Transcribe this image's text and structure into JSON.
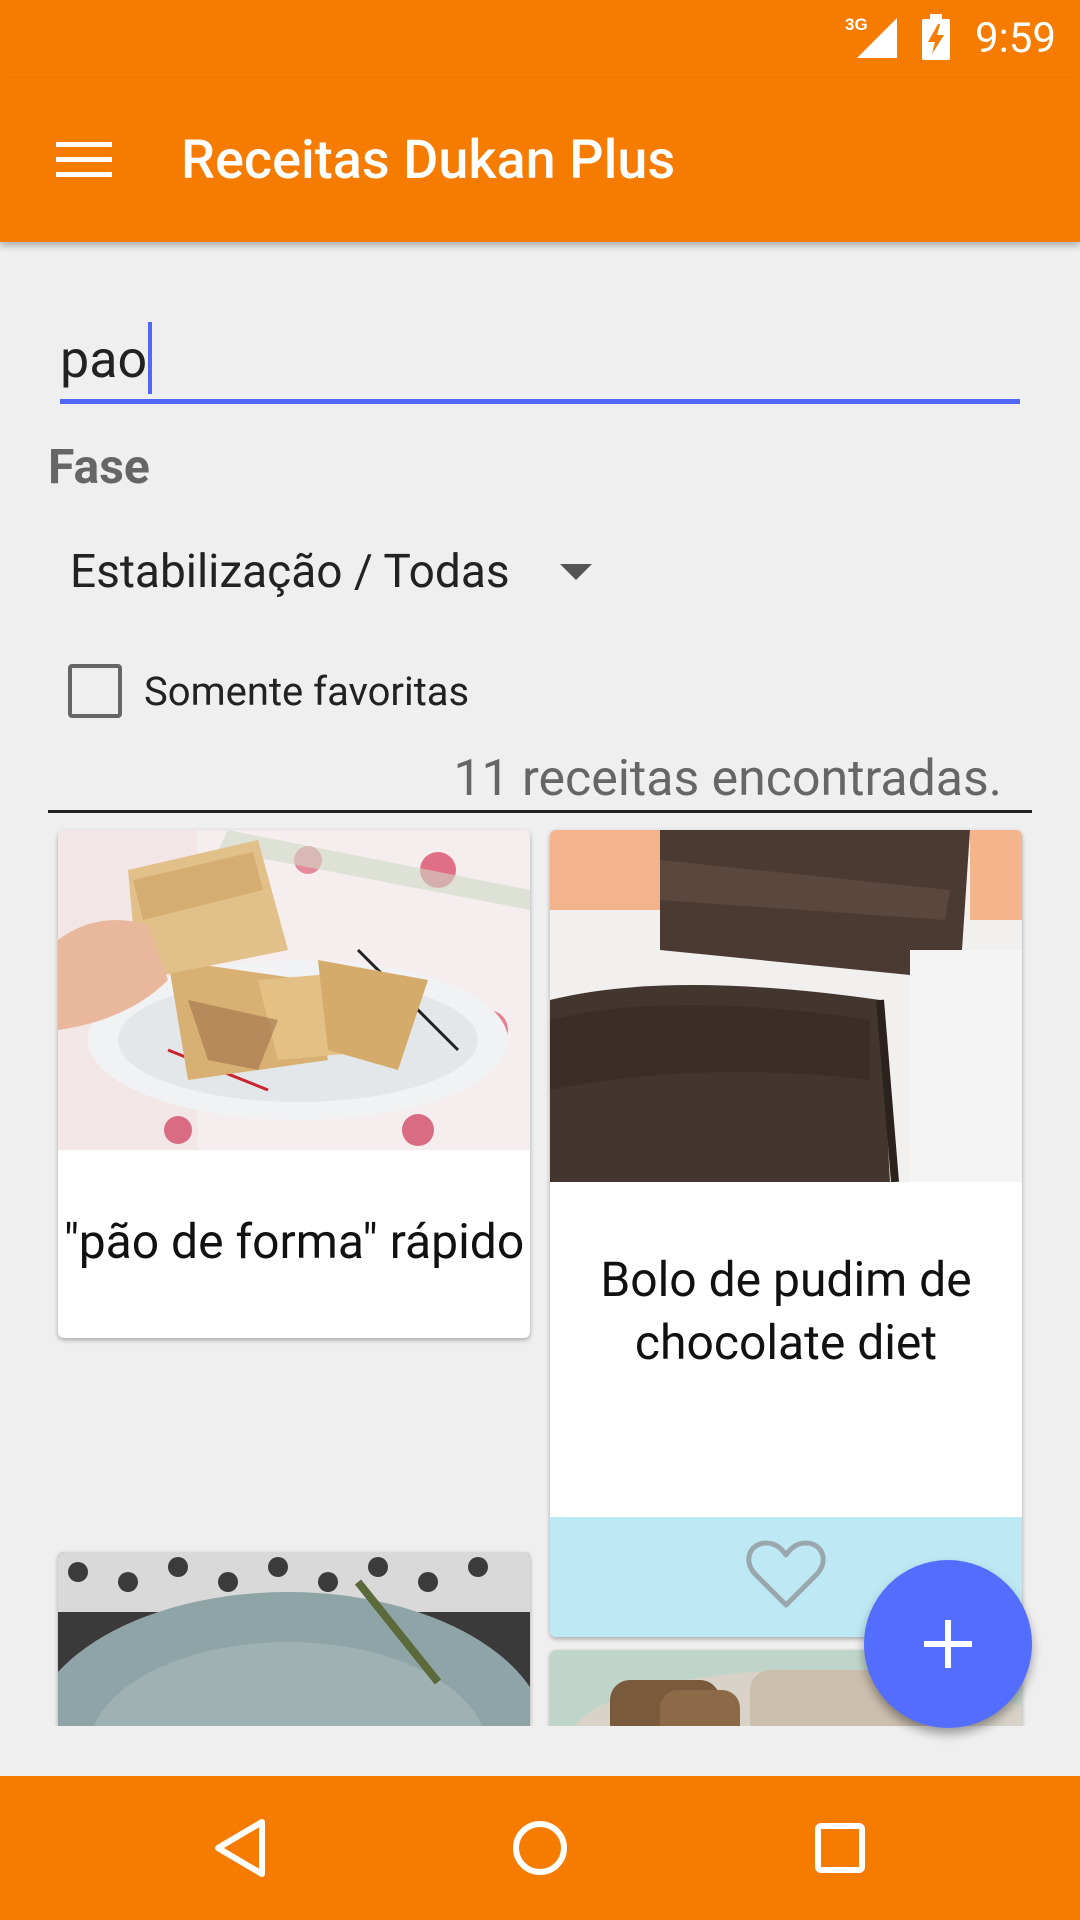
{
  "status_bar": {
    "time": "9:59",
    "network": "3G",
    "network_icon": "signal-3g-icon",
    "battery_icon": "battery-charging-icon"
  },
  "app_bar": {
    "title": "Receitas Dukan Plus",
    "menu_icon": "hamburger-menu-icon",
    "color": "#f57c00"
  },
  "search": {
    "value": "pao"
  },
  "filter": {
    "phase_label": "Fase",
    "phase_selected": "Estabilização / Todas",
    "favorites_only_label": "Somente favoritas",
    "favorites_only_checked": false
  },
  "results": {
    "count_text": "11 receitas encontradas."
  },
  "recipes": [
    {
      "title": "\"pão de forma\" rápido",
      "favorite": false,
      "image": "toasted bread slices on plate"
    },
    {
      "title": "Bolo de pudim de chocolate diet",
      "favorite": false,
      "image": "chocolate loaf cake"
    },
    {
      "title": "",
      "favorite": false,
      "image": "food on plate"
    },
    {
      "title": "",
      "favorite": false,
      "image": "sliced bread"
    }
  ],
  "fab": {
    "icon": "plus-icon",
    "color": "#536dfe"
  },
  "nav_bar": {
    "back_icon": "back-triangle-icon",
    "home_icon": "home-circle-icon",
    "recents_icon": "recents-square-icon"
  },
  "colors": {
    "primary": "#f57c00",
    "accent": "#536dfe",
    "card_footer": "#bde9f5"
  }
}
